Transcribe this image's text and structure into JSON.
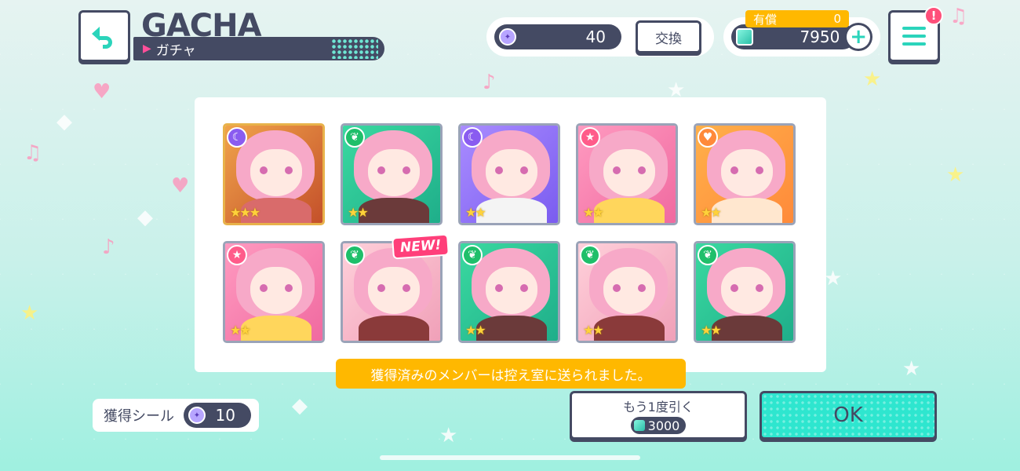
{
  "header": {
    "title": "GACHA",
    "subtitle": "ガチャ"
  },
  "currency": {
    "seal_count": "40",
    "exchange_label": "交換",
    "paid_label": "有償",
    "paid_value": "0",
    "gems": "7950",
    "plus": "+",
    "badge": "!"
  },
  "results": [
    {
      "attr": "moon",
      "attr_glyph": "☾",
      "attr_color": "#8a5cf0",
      "stars": "★★★",
      "bg": "linear-gradient(135deg,#f0a34a,#c4502a)",
      "body": "#d96b6b",
      "rarity": 3
    },
    {
      "attr": "leaf",
      "attr_glyph": "❦",
      "attr_color": "#1fbf6a",
      "stars": "★★",
      "bg": "linear-gradient(135deg,#3ad9a0,#1fae8a)",
      "body": "#6b3a3a",
      "rarity": 2
    },
    {
      "attr": "moon",
      "attr_glyph": "☾",
      "attr_color": "#8a5cf0",
      "stars": "★★",
      "bg": "linear-gradient(135deg,#a98cff,#7a5cf0)",
      "body": "#f4f4f4",
      "rarity": 2
    },
    {
      "attr": "star",
      "attr_glyph": "★",
      "attr_color": "#ff5c8a",
      "stars": "★★",
      "bg": "linear-gradient(135deg,#ff9ac0,#f06aa0)",
      "body": "#ffd65c",
      "rarity": 2
    },
    {
      "attr": "heart",
      "attr_glyph": "♥",
      "attr_color": "#ff8a3a",
      "stars": "★★",
      "bg": "linear-gradient(135deg,#ffb04a,#ff8a3a)",
      "body": "#ffe7cf",
      "rarity": 2
    },
    {
      "attr": "star",
      "attr_glyph": "★",
      "attr_color": "#ff5c8a",
      "stars": "★★",
      "bg": "linear-gradient(135deg,#ff9ac0,#f06aa0)",
      "body": "#ffd65c",
      "rarity": 2
    },
    {
      "attr": "leaf",
      "attr_glyph": "❦",
      "attr_color": "#1fbf6a",
      "stars": "",
      "bg": "linear-gradient(135deg,#ffd0da,#f0a0b8)",
      "body": "#8a3a3a",
      "rarity": 1
    },
    {
      "attr": "leaf",
      "attr_glyph": "❦",
      "attr_color": "#1fbf6a",
      "stars": "★★",
      "bg": "linear-gradient(135deg,#3ad9a0,#1fae8a)",
      "body": "#6b3a3a",
      "rarity": 2
    },
    {
      "attr": "leaf",
      "attr_glyph": "❦",
      "attr_color": "#1fbf6a",
      "stars": "★★",
      "bg": "linear-gradient(135deg,#ffd0da,#f0a0b8)",
      "body": "#8a3a3a",
      "rarity": 2
    },
    {
      "attr": "leaf",
      "attr_glyph": "❦",
      "attr_color": "#1fbf6a",
      "stars": "★★",
      "bg": "linear-gradient(135deg,#3ad9a0,#1fae8a)",
      "body": "#6b3a3a",
      "rarity": 2
    }
  ],
  "new_tag": "NEW!",
  "notice": "獲得済みのメンバーは控え室に送られました。",
  "seals": {
    "label": "獲得シール",
    "value": "10"
  },
  "again_button": {
    "label": "もう1度引く",
    "cost": "3000"
  },
  "ok_label": "OK",
  "colors": {
    "navy": "#444a63",
    "teal": "#2ee6cf",
    "gold": "#ffb800",
    "pink": "#ff3f7a"
  }
}
